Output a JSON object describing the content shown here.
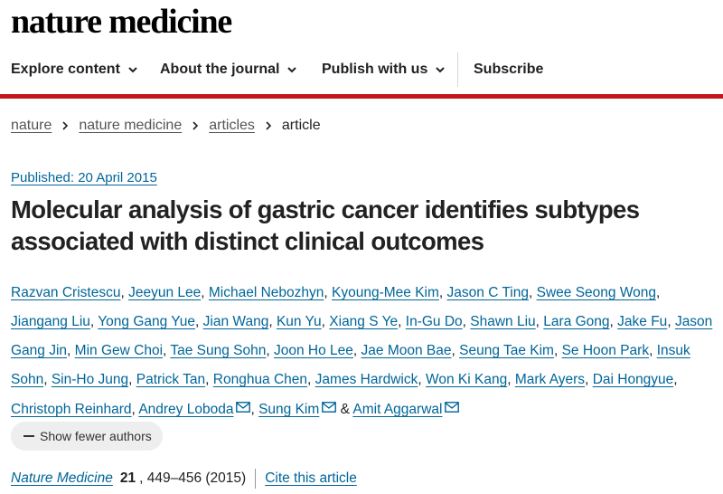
{
  "brand": "nature medicine",
  "nav": {
    "items": [
      {
        "label": "Explore content"
      },
      {
        "label": "About the journal"
      },
      {
        "label": "Publish with us"
      }
    ],
    "subscribe": "Subscribe"
  },
  "breadcrumb": [
    "nature",
    "nature medicine",
    "articles",
    "article"
  ],
  "article": {
    "published": "Published: 20 April 2015",
    "title_line1": "Molecular analysis of gastric cancer identifies subtypes",
    "title_line2": "associated with distinct clinical outcomes",
    "authors": [
      "Razvan Cristescu",
      "Jeeyun Lee",
      "Michael Nebozhyn",
      "Kyoung-Mee Kim",
      "Jason C Ting",
      "Swee Seong Wong",
      "Jiangang Liu",
      "Yong Gang Yue",
      "Jian Wang",
      "Kun Yu",
      "Xiang S Ye",
      "In-Gu Do",
      "Shawn Liu",
      "Lara Gong",
      "Jake Fu",
      "Jason Gang Jin",
      "Min Gew Choi",
      "Tae Sung Sohn",
      "Joon Ho Lee",
      "Jae Moon Bae",
      "Seung Tae Kim",
      "Se Hoon Park",
      "Insuk Sohn",
      "Sin-Ho Jung",
      "Patrick Tan",
      "Ronghua Chen",
      "James Hardwick",
      "Won Ki Kang",
      "Mark Ayers",
      "Dai Hongyue",
      "Christoph Reinhard",
      "Andrey Loboda",
      "Sung Kim",
      "Amit Aggarwal"
    ],
    "ampersand": "&",
    "show_fewer": "Show fewer authors",
    "journal": "Nature Medicine",
    "volume": "21",
    "pages": ", 449–456 (2015)",
    "cite": "Cite this article"
  },
  "colors": {
    "accent_red": "#c4171d",
    "link_blue": "#006699"
  }
}
